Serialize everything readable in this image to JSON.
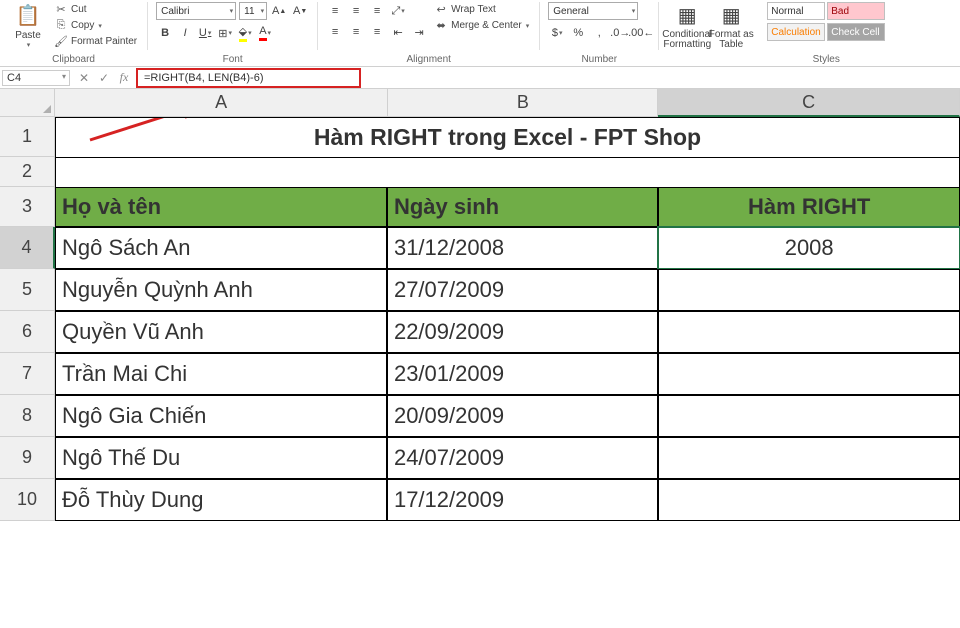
{
  "ribbon": {
    "clipboard": {
      "paste": "Paste",
      "cut": "Cut",
      "copy": "Copy",
      "formatPainter": "Format Painter",
      "label": "Clipboard"
    },
    "font": {
      "name": "Calibri",
      "size": "11",
      "label": "Font"
    },
    "alignment": {
      "wrap": "Wrap Text",
      "merge": "Merge & Center",
      "label": "Alignment"
    },
    "number": {
      "format": "General",
      "label": "Number"
    },
    "styles": {
      "condFmt": "Conditional Formatting",
      "fmtTable": "Format as Table",
      "normal": "Normal",
      "bad": "Bad",
      "calc": "Calculation",
      "check": "Check Cell",
      "label": "Styles"
    }
  },
  "formulaBar": {
    "cellRef": "C4",
    "formula": "=RIGHT(B4, LEN(B4)-6)"
  },
  "sheet": {
    "cols": [
      "A",
      "B",
      "C"
    ],
    "title": "Hàm RIGHT trong Excel - FPT Shop",
    "headers": {
      "a": "Họ và tên",
      "b": "Ngày sinh",
      "c": "Hàm RIGHT"
    },
    "rows": [
      {
        "n": "4",
        "a": "Ngô Sách An",
        "b": "31/12/2008",
        "c": "2008"
      },
      {
        "n": "5",
        "a": "Nguyễn Quỳnh Anh",
        "b": "27/07/2009",
        "c": ""
      },
      {
        "n": "6",
        "a": "Quyền Vũ Anh",
        "b": "22/09/2009",
        "c": ""
      },
      {
        "n": "7",
        "a": "Trần Mai Chi",
        "b": "23/01/2009",
        "c": ""
      },
      {
        "n": "8",
        "a": "Ngô Gia Chiến",
        "b": "20/09/2009",
        "c": ""
      },
      {
        "n": "9",
        "a": "Ngô Thế Du",
        "b": "24/07/2009",
        "c": ""
      },
      {
        "n": "10",
        "a": "Đỗ Thùy Dung",
        "b": "17/12/2009",
        "c": ""
      }
    ]
  }
}
